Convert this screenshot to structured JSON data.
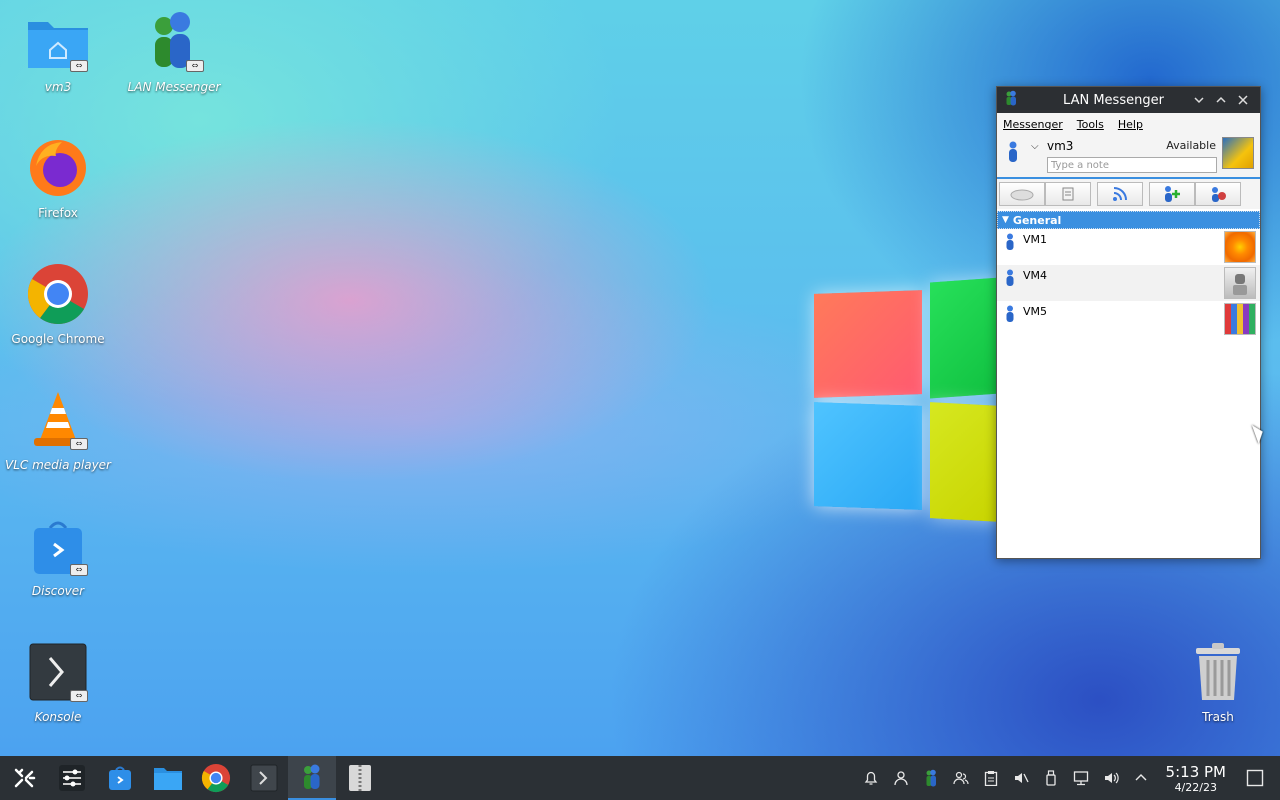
{
  "desktop": {
    "icons": [
      {
        "label": "vm3"
      },
      {
        "label": "LAN Messenger"
      },
      {
        "label": "Firefox"
      },
      {
        "label": "Google Chrome"
      },
      {
        "label": "VLC media player"
      },
      {
        "label": "Discover"
      },
      {
        "label": "Konsole"
      },
      {
        "label": "Trash"
      }
    ]
  },
  "messenger": {
    "title": "LAN Messenger",
    "menu": [
      "Messenger",
      "Tools",
      "Help"
    ],
    "user": {
      "name": "vm3",
      "status": "Available",
      "note_placeholder": "Type a note"
    },
    "group": "General",
    "contacts": [
      {
        "name": "VM1"
      },
      {
        "name": "VM4"
      },
      {
        "name": "VM5"
      }
    ]
  },
  "taskbar": {
    "clock_time": "5:13 PM",
    "clock_date": "4/22/23"
  }
}
